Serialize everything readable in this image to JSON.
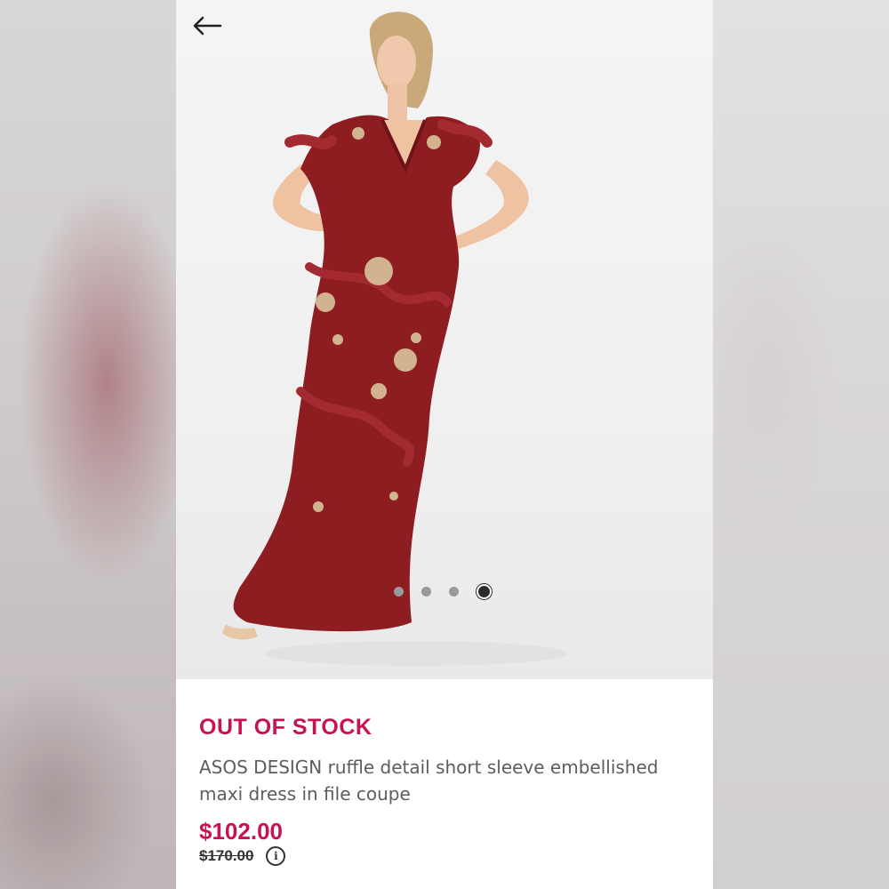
{
  "product": {
    "stock_status": "OUT OF STOCK",
    "title": "ASOS DESIGN ruffle detail short sleeve embellished maxi dress in file coupe",
    "price": "$102.00",
    "original_price": "$170.00"
  },
  "gallery": {
    "image_count": 4,
    "active_index": 4
  },
  "icons": {
    "back": "arrow-left-icon",
    "info": "info-circle-icon"
  },
  "colors": {
    "accent": "#c8144e",
    "dress": "#8e1d22",
    "text": "#5d5d5d"
  }
}
